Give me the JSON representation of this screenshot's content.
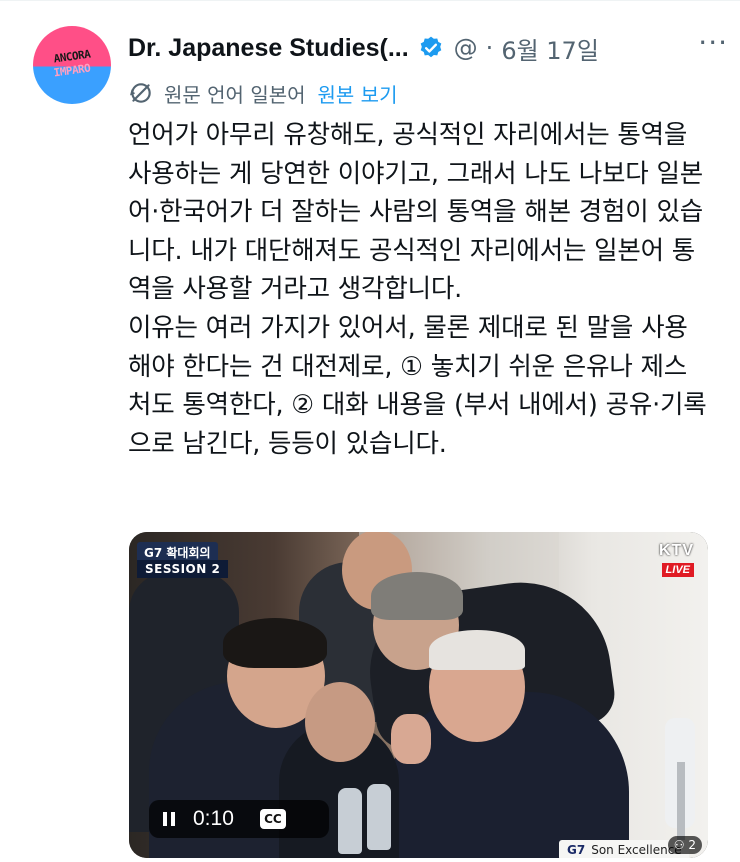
{
  "tweet": {
    "author_name": "Dr. Japanese Studies(...",
    "handle": "@",
    "separator": "·",
    "date": "6월 17일",
    "more_glyph": "···",
    "avatar_text_top": "ANCORA",
    "avatar_text_bottom": "IMPARO",
    "verified_color": "#1d9bf0",
    "translation_label": "원문 언어 일본어",
    "translation_link": "원본 보기",
    "body_paragraphs": [
      "언어가 아무리 유창해도, 공식적인 자리에서는 통역을 사용하는 게 당연한 이야기고, 그래서 나도 나보다 일본어·한국어가 더 잘하는 사람의 통역을 해본 경험이 있습니다. 내가 대단해져도 공식적인 자리에서는 일본어 통역을 사용할 거라고 생각합니다.",
      "이유는 여러 가지가 있어서, 물론 제대로 된 말을 사용해야 한다는 건 대전제로, ① 놓치기 쉬운 은유나 제스처도 통역한다, ② 대화 내용을 (부서 내에서) 공유·기록으로 남긴다, 등등이 있습니다."
    ]
  },
  "video": {
    "badge_g7": "G7 확대회의",
    "badge_session": "SESSION 2",
    "channel": "KTV",
    "live_label": "LIVE",
    "time": "0:10",
    "cc_label": "CC",
    "nameplate_brand": "G7",
    "nameplate_text": "Son Excellence Monsieur",
    "viewer_label": "⚇ 2"
  },
  "colors": {
    "accent": "#1d9bf0",
    "secondary_text": "#536471",
    "primary_text": "#0f1419",
    "live_red": "#e01b24"
  }
}
